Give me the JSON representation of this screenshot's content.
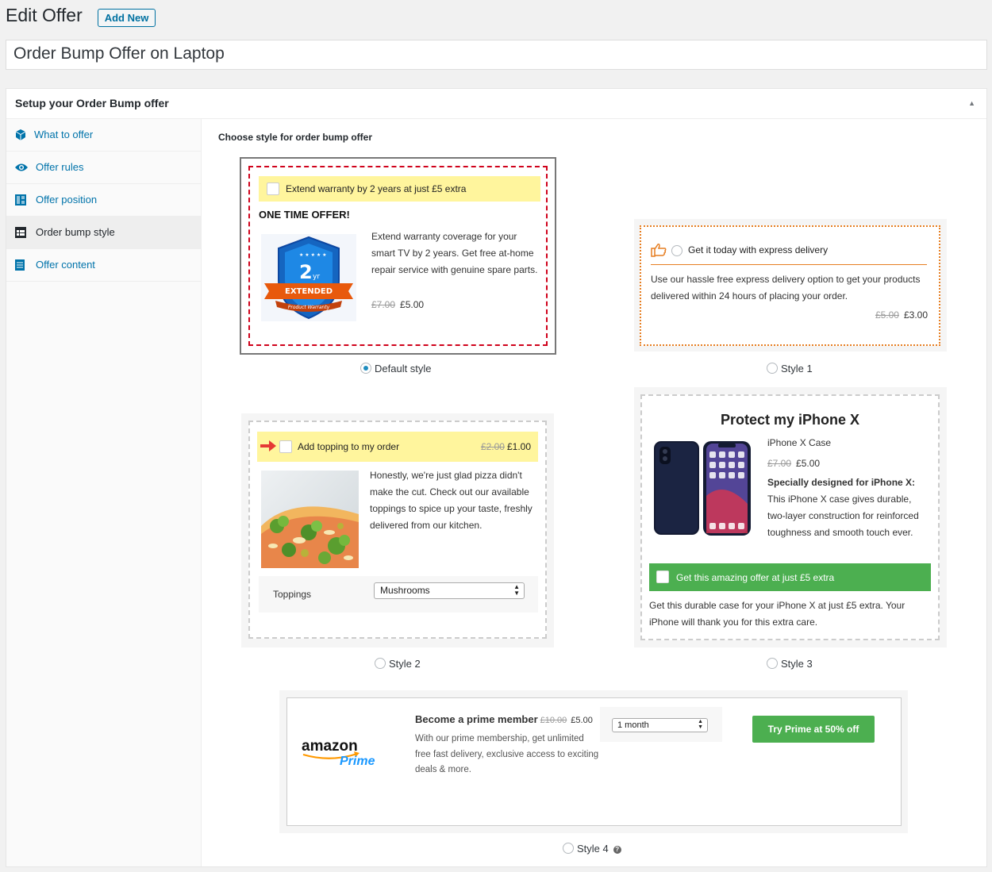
{
  "header": {
    "title": "Edit Offer",
    "add_new": "Add New",
    "offer_title": "Order Bump Offer on Laptop"
  },
  "postbox": {
    "title": "Setup your Order Bump offer"
  },
  "sidebar": {
    "items": [
      {
        "label": "What to offer",
        "icon": "cube-icon"
      },
      {
        "label": "Offer rules",
        "icon": "eye-icon"
      },
      {
        "label": "Offer position",
        "icon": "layout-icon"
      },
      {
        "label": "Order bump style",
        "icon": "table-icon",
        "active": true
      },
      {
        "label": "Offer content",
        "icon": "document-icon"
      }
    ]
  },
  "main": {
    "choose_label": "Choose style for order bump offer"
  },
  "styles": {
    "default": {
      "checkbox_text": "Extend warranty by 2 years at just £5 extra",
      "heading": "ONE TIME OFFER!",
      "description": "Extend warranty coverage for your smart TV by 2 years. Get free at-home repair service with genuine spare parts.",
      "old_price": "£7.00",
      "price": "£5.00",
      "badge": {
        "number": "2",
        "sup": "yr",
        "ribbon": "EXTENDED",
        "sub": "Product Warranty"
      },
      "radio_label": "Default style",
      "selected": true
    },
    "style1": {
      "headline": "Get it today with express delivery",
      "description": "Use our hassle free express delivery option to get your products delivered within 24 hours of placing your order.",
      "old_price": "£5.00",
      "price": "£3.00",
      "radio_label": "Style 1"
    },
    "style2": {
      "checkbox_text": "Add topping to my order",
      "old_price": "£2.00",
      "price": "£1.00",
      "description": "Honestly, we're just glad pizza didn't make the cut. Check out our available toppings to spice up your taste, freshly delivered from our kitchen.",
      "toppings_label": "Toppings",
      "toppings_value": "Mushrooms",
      "radio_label": "Style 2"
    },
    "style3": {
      "title": "Protect my iPhone X",
      "product_name": "iPhone X Case",
      "old_price": "£7.00",
      "price": "£5.00",
      "desc_bold": "Specially designed for iPhone X:",
      "desc_rest": "This iPhone X case gives durable, two-layer construction for reinforced toughness and smooth touch ever.",
      "checkbox_text": "Get this amazing offer at just £5 extra",
      "footer": "Get this durable case for your iPhone X at just £5 extra. Your iPhone will thank you for this extra care.",
      "radio_label": "Style 3"
    },
    "style4": {
      "logo_word": "amazon",
      "logo_sub": "Prime",
      "title": "Become a prime member",
      "old_price": "£10.00",
      "price": "£5.00",
      "description": "With our prime membership, get unlimited free fast delivery, exclusive access to exciting deals & more.",
      "select_value": "1 month",
      "cta": "Try Prime at 50% off",
      "radio_label": "Style 4"
    }
  },
  "colors": {
    "link": "#0073aa",
    "highlight_yellow": "#fff59d",
    "green": "#4caf50",
    "red_dashed": "#d0021b",
    "orange_dotted": "#e67e22"
  }
}
